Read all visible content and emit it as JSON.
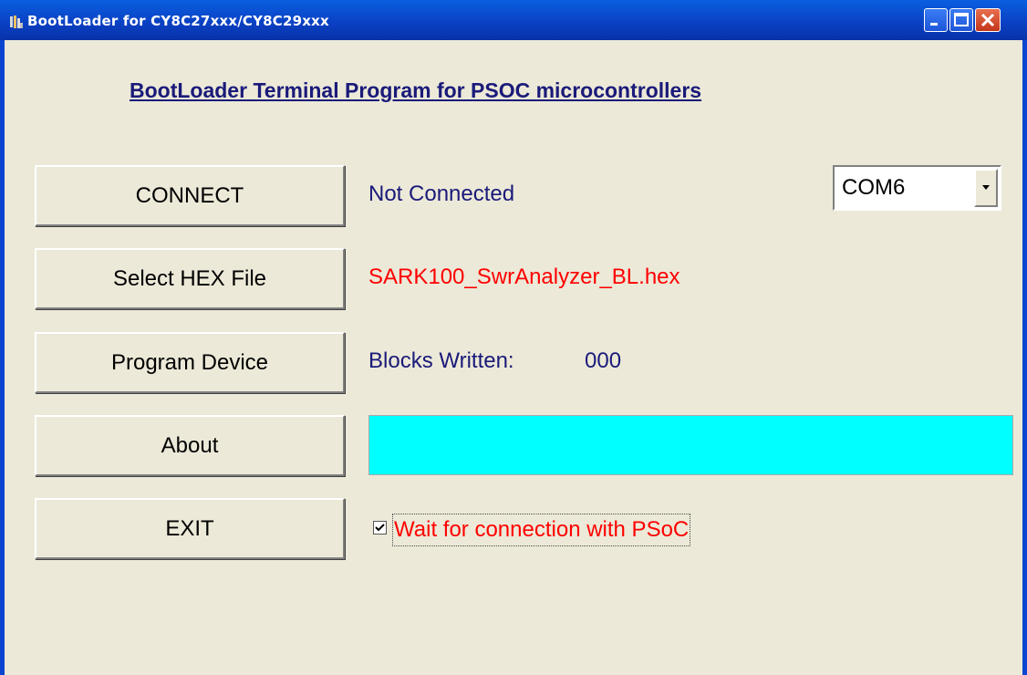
{
  "window": {
    "title": "BootLoader for CY8C27xxx/CY8C29xxx",
    "app_icon": "bootloader-app-icon",
    "controls": [
      "minimize-icon",
      "maximize-icon",
      "close-icon"
    ]
  },
  "heading": "BootLoader Terminal Program for PSOC microcontrollers",
  "buttons": {
    "connect": "CONNECT",
    "select_hex": "Select HEX File",
    "program": "Program Device",
    "about": "About",
    "exit": "EXIT"
  },
  "status": {
    "connection": "Not Connected",
    "hex_file": "SARK100_SwrAnalyzer_BL.hex",
    "blocks_label": "Blocks Written:",
    "blocks_value": "000"
  },
  "port": {
    "selected": "COM6"
  },
  "progress": {
    "color": "#00ffff",
    "fraction": 1.0
  },
  "wait_option": {
    "label": "Wait for connection with PSoC",
    "checked": true
  },
  "colors": {
    "navy_text": "#1a1a7a",
    "red_text": "#ff0000",
    "titlebar": "#0a4fd8",
    "face": "#ece9d8"
  }
}
